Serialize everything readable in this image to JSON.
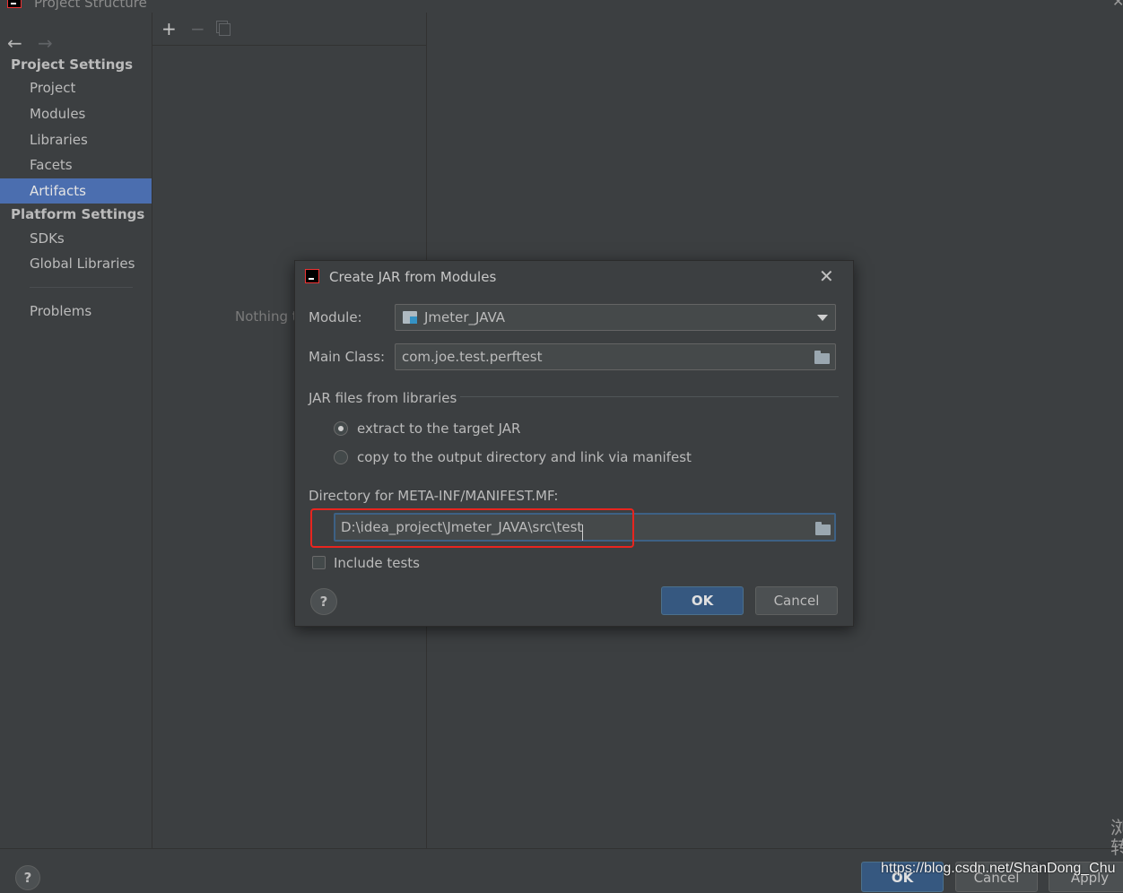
{
  "window": {
    "title": "Project Structure",
    "close_glyph": "✕"
  },
  "nav": {
    "back": "←",
    "forward": "→"
  },
  "sidebar": {
    "project_settings_header": "Project Settings",
    "project_items": [
      "Project",
      "Modules",
      "Libraries",
      "Facets",
      "Artifacts"
    ],
    "selected_item": "Artifacts",
    "platform_settings_header": "Platform Settings",
    "platform_items": [
      "SDKs",
      "Global Libraries"
    ],
    "problems": "Problems"
  },
  "middle": {
    "toolbar": {
      "add": "+",
      "remove": "−"
    },
    "empty_text": "Nothing t"
  },
  "dialog": {
    "title": "Create JAR from Modules",
    "close": "✕",
    "module_label": "Module:",
    "module_value": "Jmeter_JAVA",
    "main_class_label": "Main Class:",
    "main_class_value": "com.joe.test.perftest",
    "jar_section_label": "JAR files from libraries",
    "radio_extract_label": "extract to the target JAR",
    "radio_copy_label": "copy to the output directory and link via manifest",
    "radio_selected": "extract",
    "manifest_dir_label": "Directory for META-INF/MANIFEST.MF:",
    "manifest_dir_value": "D:\\idea_project\\Jmeter_JAVA\\src\\test",
    "include_tests_label": "Include tests",
    "include_tests_checked": false,
    "help": "?",
    "ok": "OK",
    "cancel": "Cancel"
  },
  "bottom": {
    "help": "?",
    "ok": "OK",
    "cancel": "Cancel",
    "apply": "Apply",
    "watermark": "https://blog.csdn.net/ShanDong_Chu",
    "edge_glyph": "浏\n转"
  },
  "colors": {
    "background": "#3c3f41",
    "selection": "#4b6eaf",
    "primary_button": "#365880",
    "highlight_annotation": "#e8251f",
    "focus_border": "#3d6185"
  },
  "icons": {
    "app": "intellij-icon",
    "module": "module-folder-icon",
    "browse": "folder-icon",
    "dropdown": "chevron-down-icon"
  }
}
